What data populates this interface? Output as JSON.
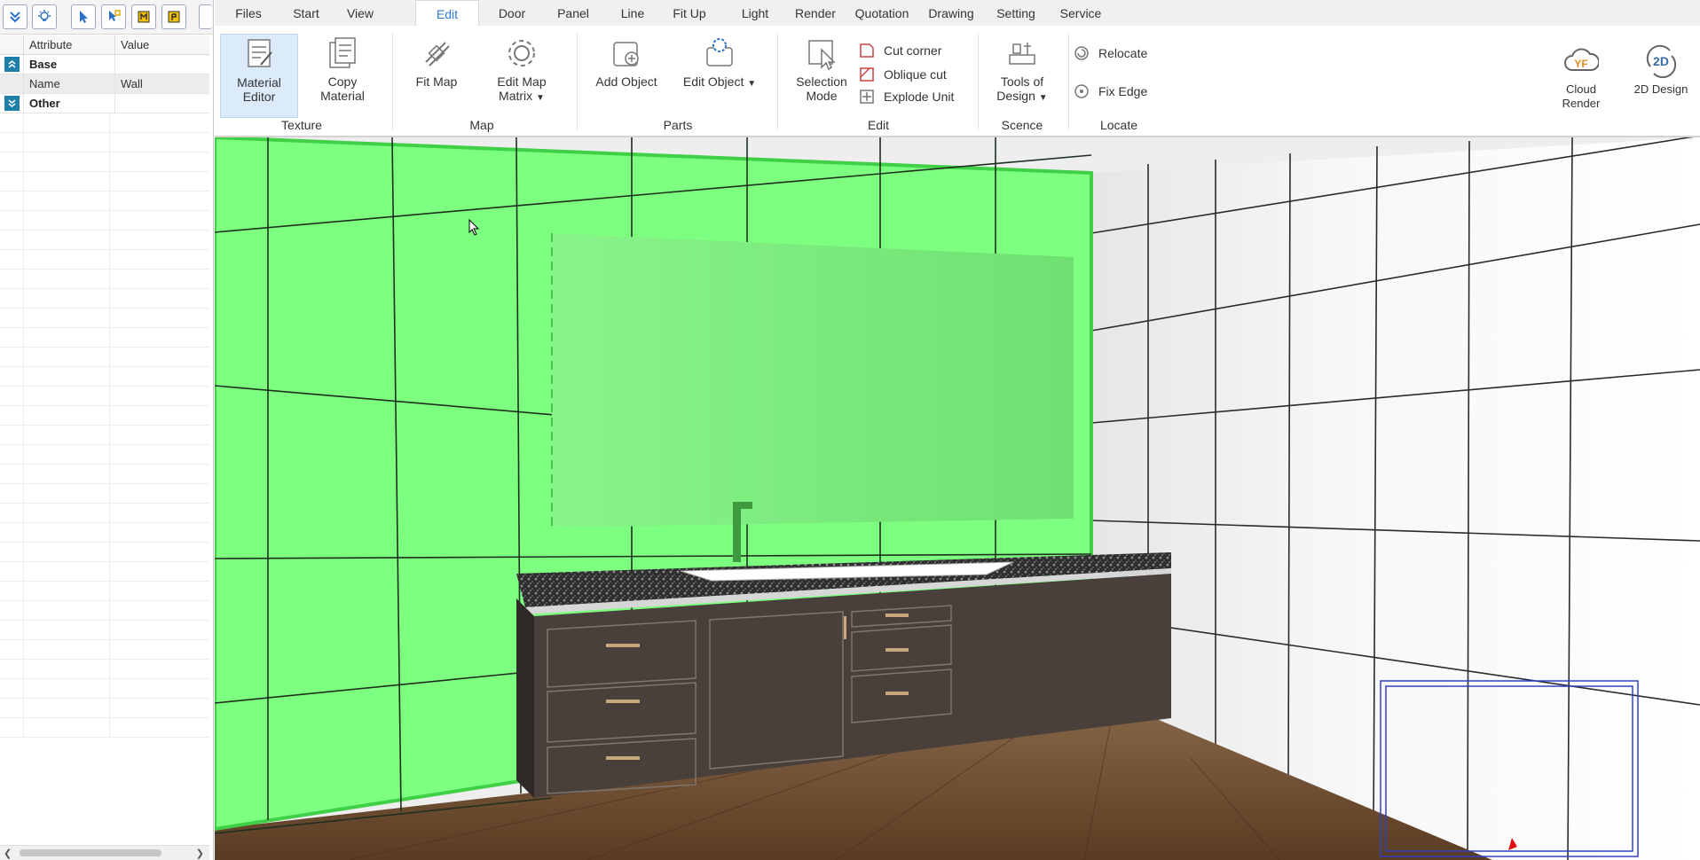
{
  "left_panel": {
    "columns": {
      "attribute": "Attribute",
      "value": "Value"
    },
    "rows": [
      {
        "group": "Base"
      },
      {
        "name": "Name",
        "value": "Wall"
      },
      {
        "group": "Other"
      }
    ]
  },
  "tabs": [
    "Files",
    "Start",
    "View",
    "Edit",
    "Door",
    "Panel",
    "Line",
    "Fit Up",
    "Light",
    "Render",
    "Quotation",
    "Drawing",
    "Setting",
    "Service"
  ],
  "active_tab": "Edit",
  "ribbon": {
    "material_editor": {
      "line1": "Material",
      "line2": "Editor"
    },
    "copy_material": {
      "line1": "Copy",
      "line2": "Material"
    },
    "fit_map": "Fit Map",
    "edit_map_matrix": {
      "line1": "Edit Map",
      "line2": "Matrix"
    },
    "add_object": "Add Object",
    "edit_object": "Edit Object",
    "selection_mode": {
      "line1": "Selection",
      "line2": "Mode"
    },
    "cut_corner": "Cut corner",
    "oblique_cut": "Oblique cut",
    "explode_unit": "Explode Unit",
    "tools_of_design": {
      "line1": "Tools of",
      "line2": "Design"
    },
    "relocate": "Relocate",
    "fix_edge": "Fix Edge",
    "cloud_render": {
      "line1": "Cloud",
      "line2": "Render",
      "logo": "YF"
    },
    "design_2d": {
      "label": "2D Design",
      "logo": "2D"
    },
    "groups": [
      "Texture",
      "Map",
      "Parts",
      "Edit",
      "Scence",
      "Locate"
    ]
  },
  "colors": {
    "accent": "#2d7bd6",
    "selected_wall": "#7dff80",
    "cabinet": "#4a403b",
    "floor": "#6b4a2f",
    "tile": "#f2f2f2"
  }
}
